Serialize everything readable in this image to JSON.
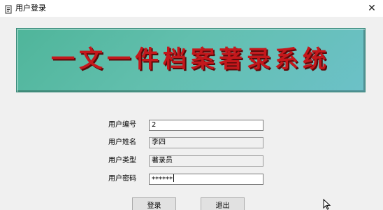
{
  "window": {
    "title": "用户登录",
    "close_glyph": "✕",
    "icon": "scroll-icon"
  },
  "banner": {
    "title": "一文一件档案著录系统",
    "text_color": "#c4181c",
    "background_color": "#5fbcaa"
  },
  "form": {
    "user_id": {
      "label": "用户编号",
      "value": "2"
    },
    "user_name": {
      "label": "用户姓名",
      "value": "李四"
    },
    "user_type": {
      "label": "用户类型",
      "value": "著录员"
    },
    "password": {
      "label": "用户密码",
      "value": "******"
    }
  },
  "buttons": {
    "login_label": "登录",
    "exit_label": "退出"
  }
}
